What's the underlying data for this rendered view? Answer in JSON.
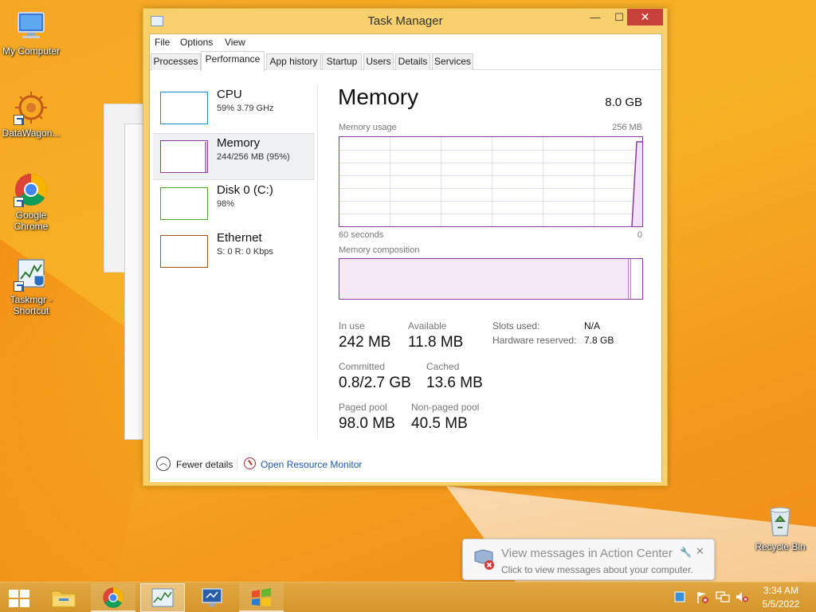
{
  "desktop": {
    "icons": [
      {
        "label": "My Computer"
      },
      {
        "label": "DataWagon..."
      },
      {
        "label": "Google Chrome"
      },
      {
        "label": "Taskmgr - Shortcut"
      },
      {
        "label": "Recycle Bin"
      }
    ]
  },
  "task_manager": {
    "title": "Task Manager",
    "window_buttons": {
      "minimize": "—",
      "maximize": "☐",
      "close": "✕"
    },
    "menu": [
      "File",
      "Options",
      "View"
    ],
    "tabs": [
      "Processes",
      "Performance",
      "App history",
      "Startup",
      "Users",
      "Details",
      "Services"
    ],
    "active_tab": "Performance",
    "resources": [
      {
        "name": "CPU",
        "detail": "59% 3.79 GHz",
        "color": "#1a8bcc"
      },
      {
        "name": "Memory",
        "detail": "244/256 MB (95%)",
        "color": "#8b3a9e",
        "selected": true
      },
      {
        "name": "Disk 0 (C:)",
        "detail": "98%",
        "color": "#4ea82a"
      },
      {
        "name": "Ethernet",
        "detail": "S: 0 R: 0 Kbps",
        "color": "#a7531a"
      }
    ],
    "memory": {
      "title": "Memory",
      "total": "8.0 GB",
      "usage_label": "Memory usage",
      "usage_max": "256 MB",
      "time_label": "60 seconds",
      "time_end": "0",
      "composition_label": "Memory composition",
      "stats": {
        "in_use_label": "In use",
        "in_use": "242 MB",
        "available_label": "Available",
        "available": "11.8 MB",
        "committed_label": "Committed",
        "committed": "0.8/2.7 GB",
        "cached_label": "Cached",
        "cached": "13.6 MB",
        "paged_label": "Paged pool",
        "paged": "98.0 MB",
        "nonpaged_label": "Non-paged pool",
        "nonpaged": "40.5 MB",
        "slots_label": "Slots used:",
        "slots": "N/A",
        "hw_reserved_label": "Hardware reserved:",
        "hw_reserved": "7.8 GB"
      }
    },
    "footer": {
      "fewer_details": "Fewer details",
      "resource_monitor": "Open Resource Monitor"
    }
  },
  "toast": {
    "title": "View messages in Action Center",
    "subtitle": "Click to view messages about your computer."
  },
  "taskbar": {
    "clock_time": "3:34 AM",
    "clock_date": "5/5/2022"
  }
}
